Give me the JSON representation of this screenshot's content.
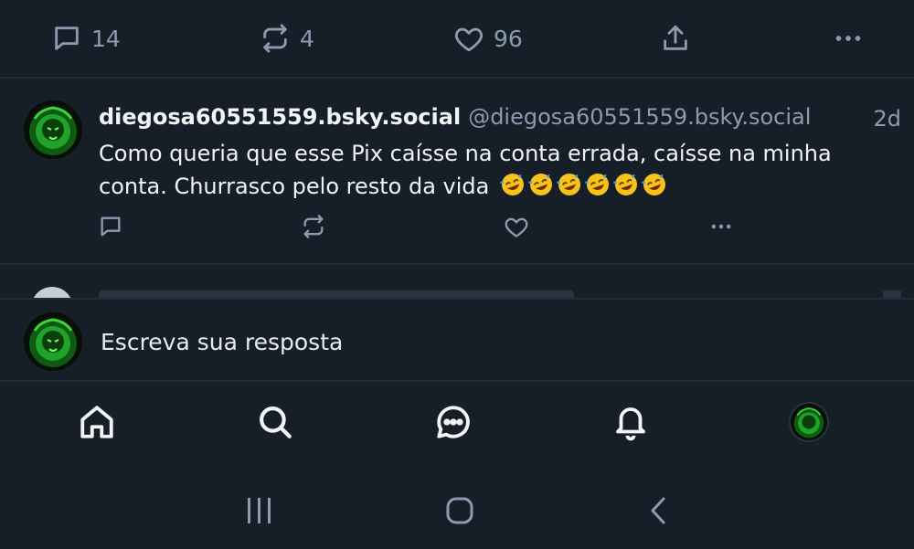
{
  "top_actions": {
    "reply_count": "14",
    "repost_count": "4",
    "like_count": "96"
  },
  "post": {
    "author": "diegosa60551559.bsky.social",
    "handle": "@diegosa60551559.bsky.social",
    "time": "2d",
    "text": "Como queria que esse Pix caísse na conta errada, caísse na minha conta. Churrasco pelo resto da vida",
    "emoji": "🤣🤣🤣🤣🤣🤣"
  },
  "composer": {
    "placeholder": "Escreva sua resposta"
  },
  "bottom_nav": {
    "items": [
      "home-icon",
      "search-icon",
      "chat-icon",
      "bell-icon",
      "profile-avatar"
    ]
  },
  "colors": {
    "background": "#161e27",
    "muted": "#8b9bb0",
    "text": "#f1f3f5",
    "separator": "#232d39"
  }
}
